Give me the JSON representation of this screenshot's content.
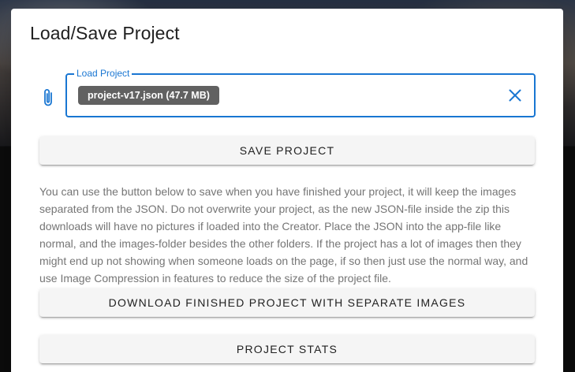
{
  "dialog": {
    "title": "Load/Save Project",
    "load_field": {
      "label": "Load Project",
      "file_chip": "project-v17.json (47.7 MB)"
    },
    "save_button": "SAVE PROJECT",
    "info_text": "You can use the button below to save when you have finished your project, it will keep the images separated from the JSON. Do not overwrite your project, as the new JSON-file inside the zip this downloads will have no pictures if loaded into the Creator. Place the JSON into the app-file like normal, and the images-folder besides the other folders. If the project has a lot of images then they might end up not showing when someone loads on the page, if so then just use the normal way, and use Image Compression in features to reduce the size of the project file.",
    "download_button": "DOWNLOAD FINISHED PROJECT WITH SEPARATE IMAGES",
    "stats_button": "PROJECT STATS"
  },
  "icons": {
    "attach": "paperclip-icon",
    "clear": "close-icon"
  },
  "colors": {
    "accent": "#1976d2",
    "chip": "#616161",
    "button_bg": "#f5f5f5"
  }
}
